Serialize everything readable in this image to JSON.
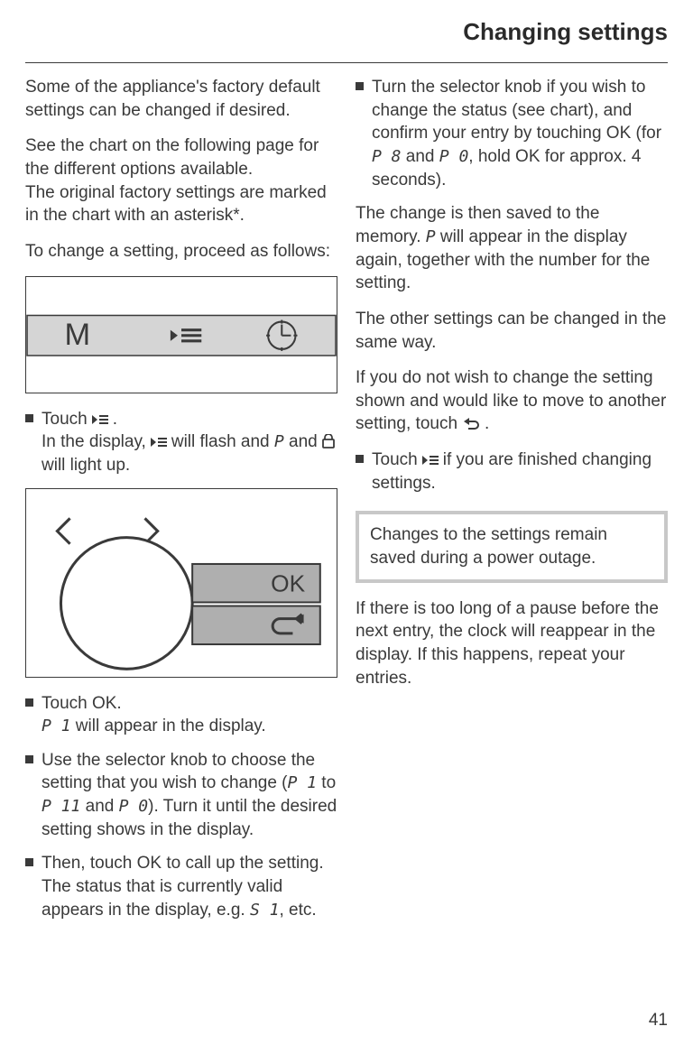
{
  "header": {
    "title": "Changing settings"
  },
  "left": {
    "p1": "Some of the appliance's factory default settings can be changed if desired.",
    "p2a": "See the chart on the following page for the different options available.",
    "p2b": "The original factory settings are marked in the chart with an asterisk*.",
    "p3": "To change a setting, proceed as follows:",
    "fig1_M": "M",
    "b1a": "Touch ",
    "b1b": ".",
    "b1c": "In the display, ",
    "b1d": " will flash and ",
    "b1e": " and ",
    "b1f": " will light up.",
    "code_P": "P",
    "fig2_OK": "OK",
    "b2a": "Touch OK.",
    "b2b": " will appear in the display.",
    "code_P1": "P 1",
    "b3a": "Use the selector knob to choose the setting that you wish to change (",
    "b3b": " to ",
    "b3c": " and ",
    "b3d": "). Turn it until the desired setting shows in the display.",
    "code_P11": "P 11",
    "code_P0": "P 0",
    "b4a": "Then, touch OK to call up the setting. The status that is currently valid appears in the display, e.g. ",
    "b4b": ", etc.",
    "code_S1": "S 1"
  },
  "right": {
    "b1a": "Turn the selector knob if you wish to change the status (see chart), and confirm your entry by touching OK (for ",
    "b1b": " and ",
    "b1c": ", hold OK for approx. 4 seconds).",
    "code_P8": "P 8",
    "code_P0": "P 0",
    "p2a": "The change is then saved to the memory. ",
    "p2b": " will appear in the display again, together with the number for the setting.",
    "code_P": "P",
    "p3": "The other settings can be changed in the same way.",
    "p4a": "If you do not wish to change the setting shown and would like to move to another setting, touch ",
    "p4b": ".",
    "b2a": "Touch ",
    "b2b": " if you are finished changing settings.",
    "note": "Changes to the settings remain saved during a power outage.",
    "p5": "If there is too long of a pause before the next entry, the clock will reappear in the display. If this happens, repeat your entries."
  },
  "pagenum": "41"
}
